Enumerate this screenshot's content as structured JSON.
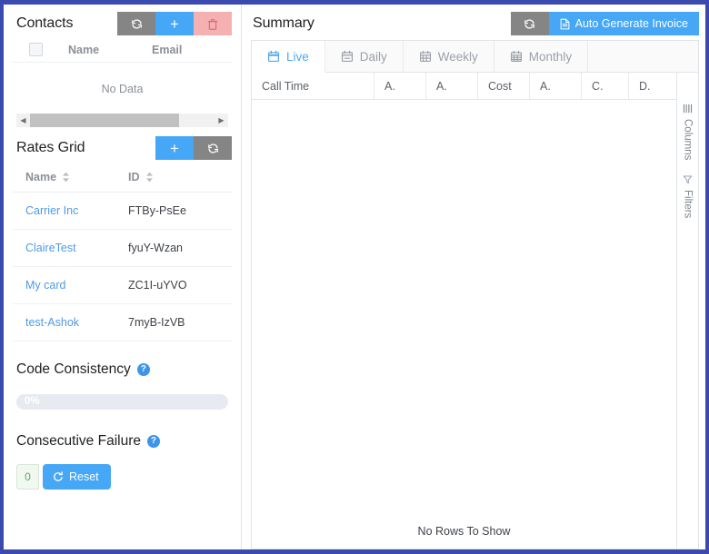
{
  "window": {
    "border_color": "#3b4aae"
  },
  "colors": {
    "blue": "#45a7f5",
    "gray_btn": "#858585",
    "pink_btn": "#f5b1b1",
    "link_blue": "#4f9ae6",
    "tab_active": "#51a8ee",
    "green": "#5eaa5e"
  },
  "left": {
    "contacts": {
      "title": "Contacts",
      "buttons": [
        {
          "name": "refresh",
          "icon": "refresh-icon",
          "label": ""
        },
        {
          "name": "add",
          "icon": "plus-icon",
          "label": "+"
        },
        {
          "name": "delete",
          "icon": "trash-icon",
          "label": ""
        }
      ],
      "columns": [
        "Name",
        "Email"
      ],
      "empty_text": "No Data",
      "select_all_checked": false
    },
    "rates_grid": {
      "title": "Rates Grid",
      "buttons": [
        {
          "name": "add",
          "icon": "plus-icon",
          "label": "+"
        },
        {
          "name": "refresh",
          "icon": "refresh-icon",
          "label": ""
        }
      ],
      "columns": [
        "Name",
        "ID"
      ],
      "rows": [
        {
          "name": "Carrier Inc",
          "id": "FTBy-PsEe"
        },
        {
          "name": "ClaireTest",
          "id": "fyuY-Wzan"
        },
        {
          "name": "My card",
          "id": "ZC1I-uYVO"
        },
        {
          "name": "test-Ashok",
          "id": "7myB-IzVB"
        }
      ]
    },
    "code_consistency": {
      "title": "Code Consistency",
      "help_label": "?",
      "progress_text": "0%",
      "progress_value": 0
    },
    "consecutive_failure": {
      "title": "Consecutive Failure",
      "help_label": "?",
      "count": "0",
      "reset_label": "Reset"
    }
  },
  "right": {
    "title": "Summary",
    "refresh_button": {
      "name": "refresh",
      "icon": "refresh-icon"
    },
    "invoice_button": {
      "label": "Auto Generate Invoice",
      "icon": "document-icon"
    },
    "tabs": [
      {
        "label": "Live",
        "icon": "calendar-live-icon",
        "active": true
      },
      {
        "label": "Daily",
        "icon": "calendar-day-icon",
        "active": false
      },
      {
        "label": "Weekly",
        "icon": "calendar-week-icon",
        "active": false
      },
      {
        "label": "Monthly",
        "icon": "calendar-month-icon",
        "active": false
      }
    ],
    "grid": {
      "columns": [
        {
          "label": "Call Time",
          "width": 135
        },
        {
          "label": "A.",
          "width": 57
        },
        {
          "label": "A.",
          "width": 57
        },
        {
          "label": "Cost",
          "width": 57
        },
        {
          "label": "A.",
          "width": 57
        },
        {
          "label": "C.",
          "width": 52
        },
        {
          "label": "D.",
          "width": 52
        }
      ],
      "rows": [],
      "empty_text": "No Rows To Show"
    },
    "side_panel": [
      {
        "label": "Columns",
        "icon": "columns-icon"
      },
      {
        "label": "Filters",
        "icon": "funnel-icon"
      }
    ]
  }
}
